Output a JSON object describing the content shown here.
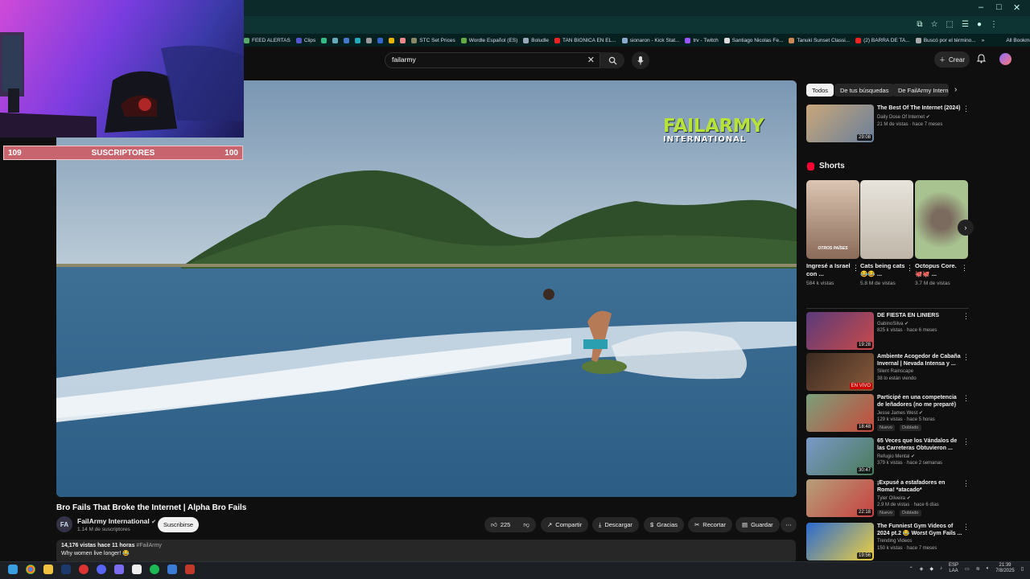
{
  "browser": {
    "window_controls": [
      "–",
      "□",
      "✕"
    ],
    "bookmarks": [
      {
        "label": "FEED ALERTAS",
        "color": "#5a6"
      },
      {
        "label": "Clips",
        "color": "#55c"
      },
      {
        "label": "",
        "color": "#3b8"
      },
      {
        "label": "",
        "color": "#6ab"
      },
      {
        "label": "",
        "color": "#47c"
      },
      {
        "label": "",
        "color": "#2ab"
      },
      {
        "label": "",
        "color": "#999"
      },
      {
        "label": "",
        "color": "#36c"
      },
      {
        "label": "",
        "color": "#e6b500"
      },
      {
        "label": "",
        "color": "#e88"
      },
      {
        "label": "STC Set Prices",
        "color": "#886"
      },
      {
        "label": "Wordle Español (ES)",
        "color": "#6a4"
      },
      {
        "label": "Boludle",
        "color": "#9ab"
      },
      {
        "label": "TAN BIONICA EN EL...",
        "color": "#e22"
      },
      {
        "label": "sionaron - Kick Stat...",
        "color": "#8ac"
      },
      {
        "label": "trv - Twitch",
        "color": "#95f"
      },
      {
        "label": "Santiago Nicolas Fe...",
        "color": "#ddd"
      },
      {
        "label": "Tanuki Sunset Classi...",
        "color": "#c85"
      },
      {
        "label": "(2) BARRA DE TA...",
        "color": "#e22"
      },
      {
        "label": "Buscó por el término...",
        "color": "#aaa"
      }
    ],
    "bookmarks_overflow": "»",
    "all_bookmarks": "All Bookmarks"
  },
  "header": {
    "search_query": "failarmy",
    "create_label": "Crear"
  },
  "overlay": {
    "left_count": "109",
    "label": "SUSCRIPTORES",
    "right_count": "100"
  },
  "video": {
    "logo_line1": "FAILARMY",
    "logo_line2": "INTERNATIONAL",
    "title": "Bro Fails That Broke the Internet | Alpha Bro Fails",
    "channel": "FailArmy International",
    "channel_avatar_text": "FA",
    "subscribers": "1.14 M de suscriptores",
    "subscribe_label": "Suscribirse",
    "likes": "225",
    "actions": {
      "share": "Compartir",
      "download": "Descargar",
      "thanks": "Gracias",
      "clip": "Recortar",
      "save": "Guardar"
    },
    "views": "14,176 vistas",
    "age": "hace 11 horas",
    "hashtag": "#FailArmy",
    "description": "Why women live longer! 😂"
  },
  "chips": [
    "Todos",
    "De tus búsquedas",
    "De FailArmy Intern"
  ],
  "top_rec": {
    "title": "The Best Of The Internet (2024)",
    "channel": "Daily Dose Of Internet",
    "meta": "21 M de vistas · hace 7 meses",
    "duration": "29:08"
  },
  "shorts": {
    "heading": "Shorts",
    "items": [
      {
        "title": "Ingresé a Israel con ...",
        "views": "584 k vistas",
        "caption": "OTROS PAÍSES"
      },
      {
        "title": "Cats being cats 😂😂 ...",
        "views": "5.8 M de vistas",
        "caption": ""
      },
      {
        "title": "Octopus Core. 🐙🐙 ...",
        "views": "3.7 M de vistas",
        "caption": ""
      }
    ]
  },
  "recommendations": [
    {
      "title": "DE FIESTA EN LINIERS",
      "channel": "GabinoSilva",
      "verified": true,
      "meta": "825 k vistas · hace 6 meses",
      "duration": "19:28",
      "live": false,
      "badges": []
    },
    {
      "title": "Ambiente Acogedor de Cabaña Invernal | Nevada Intensa y ...",
      "channel": "Silent Rainscape",
      "verified": false,
      "meta": "38 lo están viendo",
      "duration": "EN VIVO",
      "live": true,
      "badges": []
    },
    {
      "title": "Participé en una competencia de leñadores (no me preparé)",
      "channel": "Jesse James West",
      "verified": true,
      "meta": "129 k vistas · hace 5 horas",
      "duration": "18:48",
      "live": false,
      "badges": [
        "Nuevo",
        "Doblado"
      ]
    },
    {
      "title": "65 Veces que los Vándalos de las Carreteras Obtuvieron ...",
      "channel": "Refugio Mental",
      "verified": true,
      "meta": "379 k vistas · hace 2 semanas",
      "duration": "30:47",
      "live": false,
      "badges": []
    },
    {
      "title": "¡Expusé a estafadores en Roma! *atacado*",
      "channel": "Tyler Oliveira",
      "verified": true,
      "meta": "2.9 M de vistas · hace 6 días",
      "duration": "22:18",
      "live": false,
      "badges": [
        "Nuevo",
        "Doblado"
      ]
    },
    {
      "title": "The Funniest Gym Videos of 2024 pt.2 😂 Worst Gym Fails ...",
      "channel": "Trending Videos",
      "verified": false,
      "meta": "150 k vistas · hace 7 meses",
      "duration": "19:56",
      "live": false,
      "badges": []
    }
  ],
  "taskbar": {
    "language": "ESP",
    "layout": "LAA",
    "time": "21:39",
    "date": "7/8/2025"
  },
  "colors": {
    "background": "#0f0f0f",
    "accent_red": "#ff0033",
    "overlay_bar": "#c8646e",
    "chip_active": "#f1f1f1"
  }
}
